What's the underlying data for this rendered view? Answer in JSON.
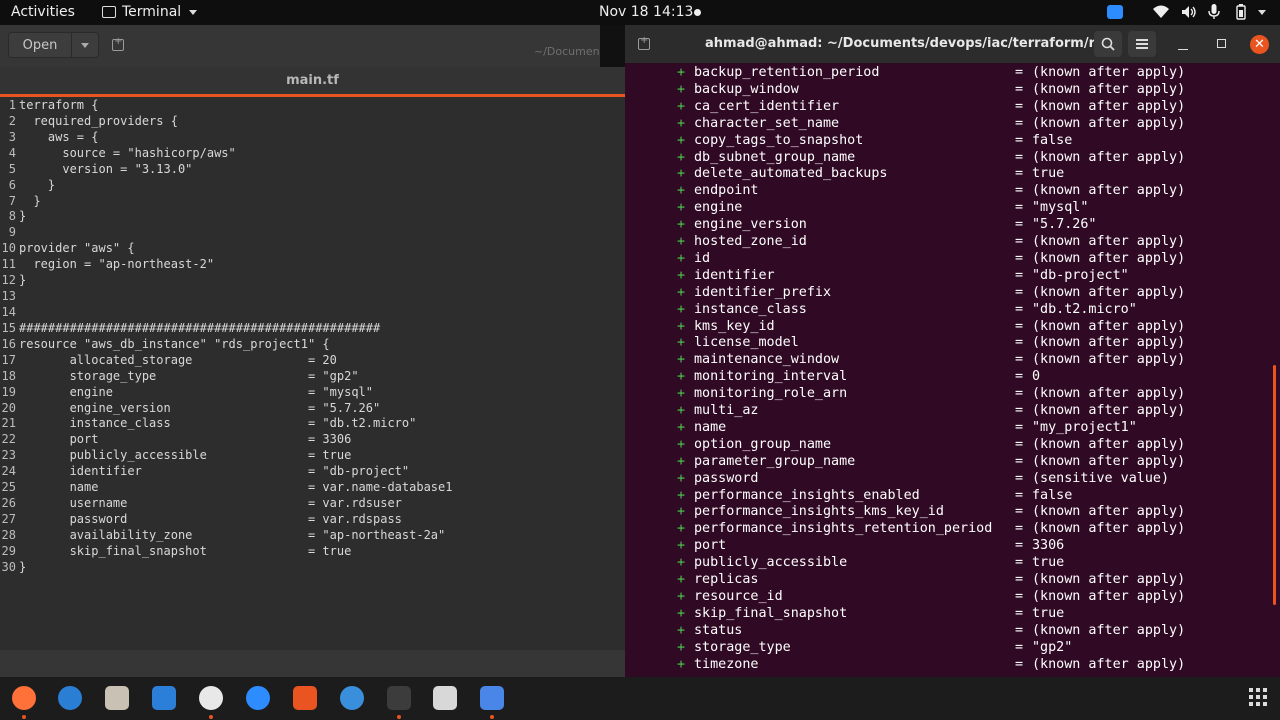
{
  "topbar": {
    "activities": "Activities",
    "app_name": "Terminal",
    "clock": "Nov 18  14:13"
  },
  "gedit": {
    "open_label": "Open",
    "path": "~/Document",
    "tab_title": "main.tf",
    "lines": [
      {
        "n": "1",
        "t": "terraform {"
      },
      {
        "n": "2",
        "t": "  required_providers {"
      },
      {
        "n": "3",
        "t": "    aws = {"
      },
      {
        "n": "4",
        "t": "      source = \"hashicorp/aws\""
      },
      {
        "n": "5",
        "t": "      version = \"3.13.0\""
      },
      {
        "n": "6",
        "t": "    }"
      },
      {
        "n": "7",
        "t": "  }"
      },
      {
        "n": "8",
        "t": "}"
      },
      {
        "n": "9",
        "t": ""
      },
      {
        "n": "10",
        "t": "provider \"aws\" {"
      },
      {
        "n": "11",
        "t": "  region = \"ap-northeast-2\""
      },
      {
        "n": "12",
        "t": "}"
      },
      {
        "n": "13",
        "t": ""
      },
      {
        "n": "14",
        "t": ""
      },
      {
        "n": "15",
        "t": "##################################################"
      },
      {
        "n": "16",
        "t": "resource \"aws_db_instance\" \"rds_project1\" {"
      },
      {
        "n": "17",
        "t": "       allocated_storage                = 20"
      },
      {
        "n": "18",
        "t": "       storage_type                     = \"gp2\""
      },
      {
        "n": "19",
        "t": "       engine                           = \"mysql\""
      },
      {
        "n": "20",
        "t": "       engine_version                   = \"5.7.26\""
      },
      {
        "n": "21",
        "t": "       instance_class                   = \"db.t2.micro\""
      },
      {
        "n": "22",
        "t": "       port                             = 3306"
      },
      {
        "n": "23",
        "t": "       publicly_accessible              = true"
      },
      {
        "n": "24",
        "t": "       identifier                       = \"db-project\""
      },
      {
        "n": "25",
        "t": "       name                             = var.name-database1"
      },
      {
        "n": "26",
        "t": "       username                         = var.rdsuser"
      },
      {
        "n": "27",
        "t": "       password                         = var.rdspass"
      },
      {
        "n": "28",
        "t": "       availability_zone                = \"ap-northeast-2a\""
      },
      {
        "n": "29",
        "t": "       skip_final_snapshot              = true"
      },
      {
        "n": "30",
        "t": "}"
      }
    ]
  },
  "terminal": {
    "title": "ahmad@ahmad: ~/Documents/devops/iac/terraform/rds",
    "attributes": [
      {
        "k": "backup_retention_period",
        "v": "(known after apply)"
      },
      {
        "k": "backup_window",
        "v": "(known after apply)"
      },
      {
        "k": "ca_cert_identifier",
        "v": "(known after apply)"
      },
      {
        "k": "character_set_name",
        "v": "(known after apply)"
      },
      {
        "k": "copy_tags_to_snapshot",
        "v": "false"
      },
      {
        "k": "db_subnet_group_name",
        "v": "(known after apply)"
      },
      {
        "k": "delete_automated_backups",
        "v": "true"
      },
      {
        "k": "endpoint",
        "v": "(known after apply)"
      },
      {
        "k": "engine",
        "v": "\"mysql\""
      },
      {
        "k": "engine_version",
        "v": "\"5.7.26\""
      },
      {
        "k": "hosted_zone_id",
        "v": "(known after apply)"
      },
      {
        "k": "id",
        "v": "(known after apply)"
      },
      {
        "k": "identifier",
        "v": "\"db-project\""
      },
      {
        "k": "identifier_prefix",
        "v": "(known after apply)"
      },
      {
        "k": "instance_class",
        "v": "\"db.t2.micro\""
      },
      {
        "k": "kms_key_id",
        "v": "(known after apply)"
      },
      {
        "k": "license_model",
        "v": "(known after apply)"
      },
      {
        "k": "maintenance_window",
        "v": "(known after apply)"
      },
      {
        "k": "monitoring_interval",
        "v": "0"
      },
      {
        "k": "monitoring_role_arn",
        "v": "(known after apply)"
      },
      {
        "k": "multi_az",
        "v": "(known after apply)"
      },
      {
        "k": "name",
        "v": "\"my_project1\""
      },
      {
        "k": "option_group_name",
        "v": "(known after apply)"
      },
      {
        "k": "parameter_group_name",
        "v": "(known after apply)"
      },
      {
        "k": "password",
        "v": "(sensitive value)"
      },
      {
        "k": "performance_insights_enabled",
        "v": "false"
      },
      {
        "k": "performance_insights_kms_key_id",
        "v": "(known after apply)"
      },
      {
        "k": "performance_insights_retention_period",
        "v": "(known after apply)"
      },
      {
        "k": "port",
        "v": "3306"
      },
      {
        "k": "publicly_accessible",
        "v": "true"
      },
      {
        "k": "replicas",
        "v": "(known after apply)"
      },
      {
        "k": "resource_id",
        "v": "(known after apply)"
      },
      {
        "k": "skip_final_snapshot",
        "v": "true"
      },
      {
        "k": "status",
        "v": "(known after apply)"
      },
      {
        "k": "storage_type",
        "v": "\"gp2\""
      },
      {
        "k": "timezone",
        "v": "(known after apply)"
      }
    ]
  },
  "dock": {
    "items": [
      {
        "name": "firefox-icon",
        "color": "#ff7139",
        "running": true
      },
      {
        "name": "thunderbird-icon",
        "color": "#2a7fd4",
        "running": false
      },
      {
        "name": "files-icon",
        "color": "#c9c2b4",
        "running": false
      },
      {
        "name": "libreoffice-writer-icon",
        "color": "#2c7fd8",
        "running": false
      },
      {
        "name": "slack-icon",
        "color": "#e8e8e8",
        "running": true
      },
      {
        "name": "zoom-icon",
        "color": "#2d8cff",
        "running": false
      },
      {
        "name": "software-center-icon",
        "color": "#e95420",
        "running": false
      },
      {
        "name": "help-icon",
        "color": "#3a8fdc",
        "running": false
      },
      {
        "name": "terminal-icon",
        "color": "#3c3c3c",
        "running": true
      },
      {
        "name": "screenshot-icon",
        "color": "#d8d8d8",
        "running": false
      },
      {
        "name": "text-editor-icon",
        "color": "#4a86e8",
        "running": true
      }
    ]
  }
}
